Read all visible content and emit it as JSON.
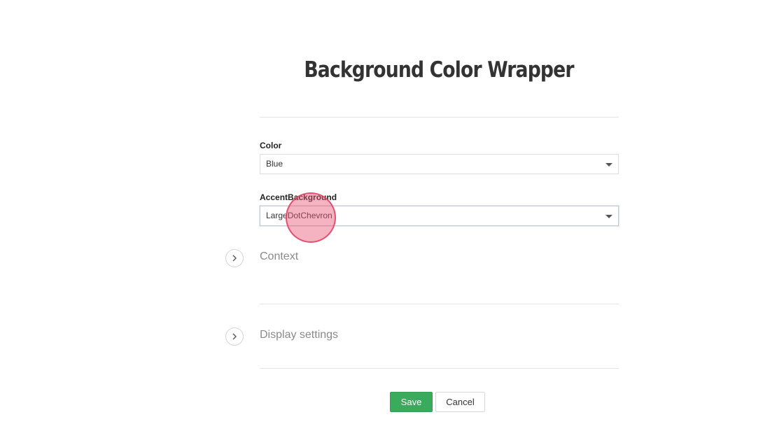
{
  "page": {
    "title": "Background Color Wrapper"
  },
  "form": {
    "color": {
      "label": "Color",
      "value": "Blue"
    },
    "accent_background": {
      "label": "AccentBackground",
      "value": "LargeDotChevron"
    }
  },
  "sections": [
    {
      "title": "Context"
    },
    {
      "title": "Display settings"
    }
  ],
  "actions": {
    "save_label": "Save",
    "cancel_label": "Cancel"
  },
  "colors": {
    "save_button": "#3aaa5c",
    "click_marker": "#e95476"
  }
}
